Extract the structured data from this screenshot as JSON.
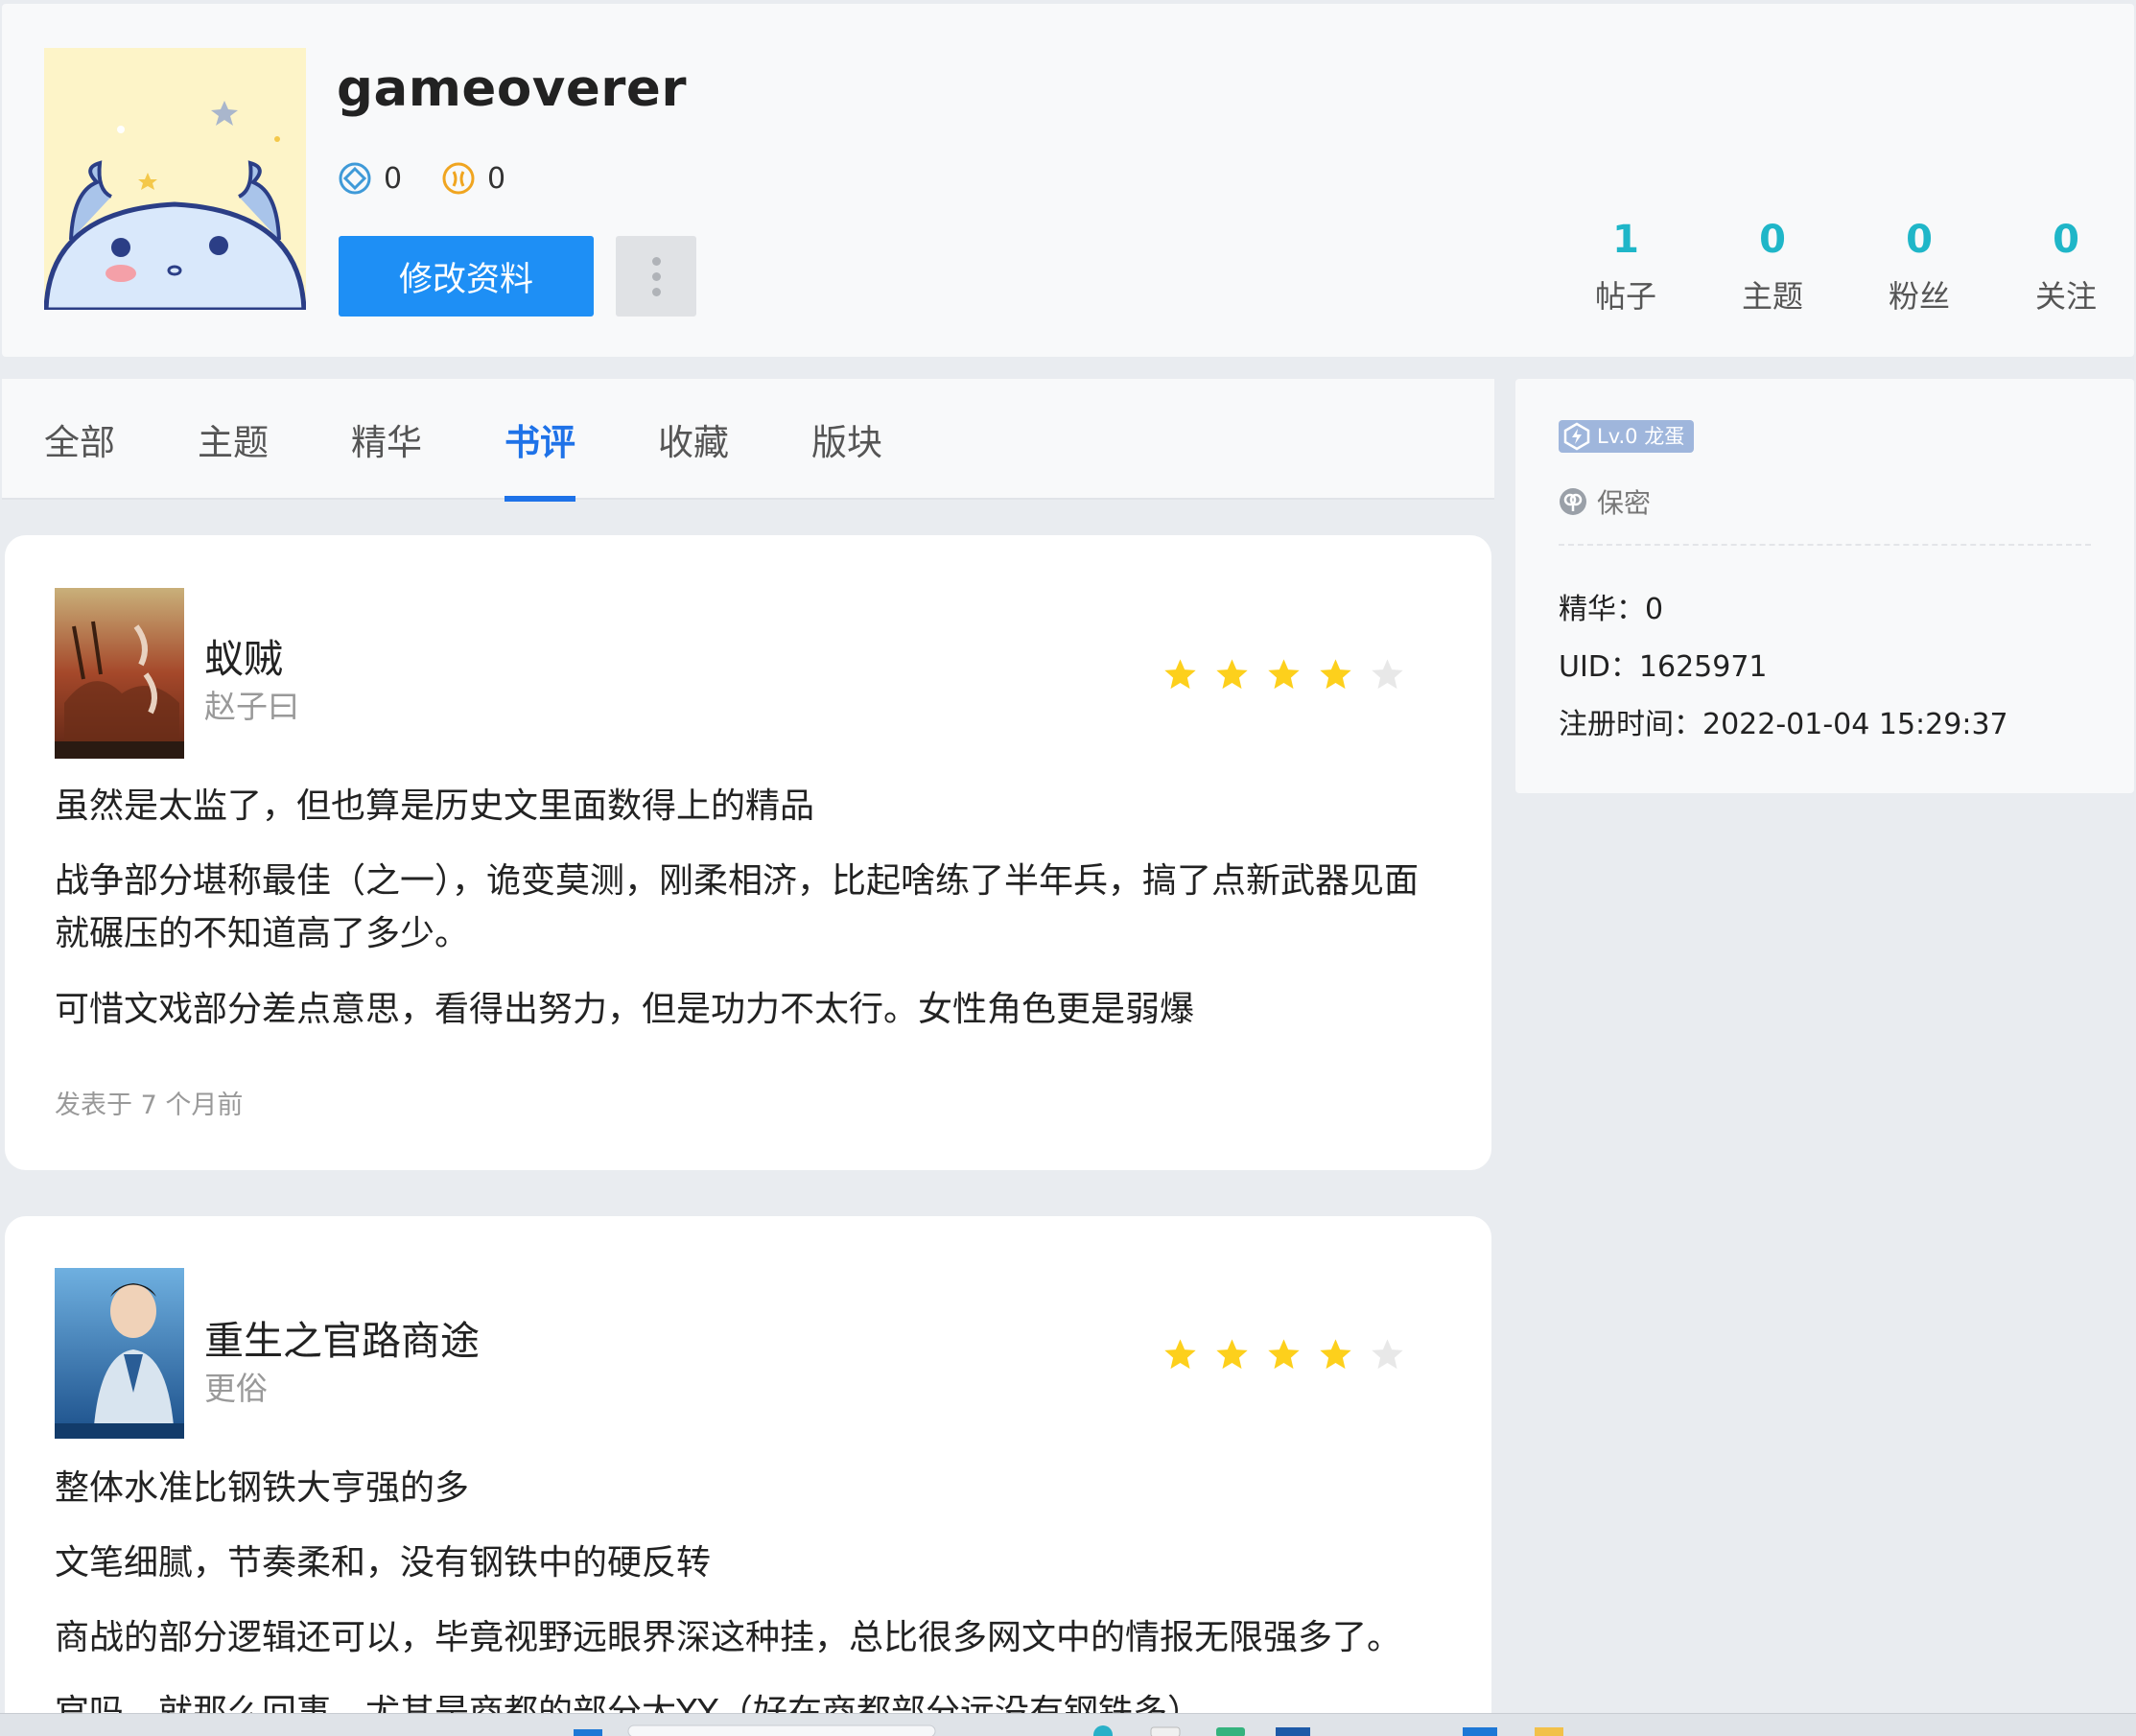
{
  "profile": {
    "username": "gameoverer",
    "currency1": "0",
    "currency2": "0",
    "edit_label": "修改资料",
    "stats": [
      {
        "num": "1",
        "label": "帖子"
      },
      {
        "num": "0",
        "label": "主题"
      },
      {
        "num": "0",
        "label": "粉丝"
      },
      {
        "num": "0",
        "label": "关注"
      }
    ]
  },
  "tabs": [
    "全部",
    "主题",
    "精华",
    "书评",
    "收藏",
    "版块"
  ],
  "active_tab": "书评",
  "sidebar": {
    "level": "Lv.0 龙蛋",
    "gender": "保密",
    "digest": "精华：0",
    "uid": "UID：1625971",
    "registered": "注册时间：2022-01-04 15:29:37"
  },
  "reviews": [
    {
      "title": "蚁贼",
      "author": "赵子曰",
      "rating": 4,
      "max_rating": 5,
      "paragraphs": [
        "虽然是太监了，但也算是历史文里面数得上的精品",
        "战争部分堪称最佳（之一），诡变莫测，刚柔相济，比起啥练了半年兵，搞了点新武器见面就碾压的不知道高了多少。",
        "可惜文戏部分差点意思，看得出努力，但是功力不太行。女性角色更是弱爆"
      ],
      "posted": "发表于 7 个月前"
    },
    {
      "title": "重生之官路商途",
      "author": "更俗",
      "rating": 4,
      "max_rating": 5,
      "paragraphs": [
        "整体水准比钢铁大亨强的多",
        "文笔细腻，节奏柔和，没有钢铁中的硬反转",
        "商战的部分逻辑还可以，毕竟视野远眼界深这种挂，总比很多网文中的情报无限强多了。",
        "官吗，就那么回事，尤其是商都的部分太YY（好在商都部分远没有钢铁多）"
      ]
    }
  ],
  "colors": {
    "accent": "#1e8ff5",
    "tab_active": "#1e72e8",
    "stat": "#1fb6c8",
    "star": "#fdd01c",
    "star_empty": "#e8e8e8"
  }
}
